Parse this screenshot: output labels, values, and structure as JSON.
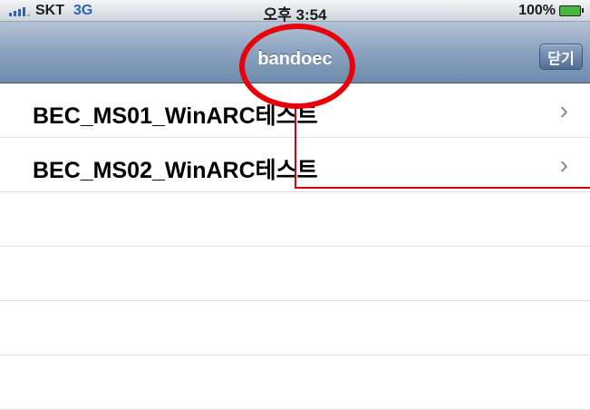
{
  "status_bar": {
    "carrier": "SKT",
    "network": "3G",
    "time": "오후 3:54",
    "battery": "100%"
  },
  "nav": {
    "title": "bandoec",
    "close_label": "닫기"
  },
  "list": {
    "items": [
      {
        "label": "BEC_MS01_WinARC테스트",
        "chevron": "›"
      },
      {
        "label": "BEC_MS02_WinARC테스트",
        "chevron": "›"
      }
    ],
    "empty_rows": 4
  },
  "colors": {
    "accent": "#2e63b8",
    "annotation": "#e8000b",
    "nav": "#8ba2bf"
  }
}
